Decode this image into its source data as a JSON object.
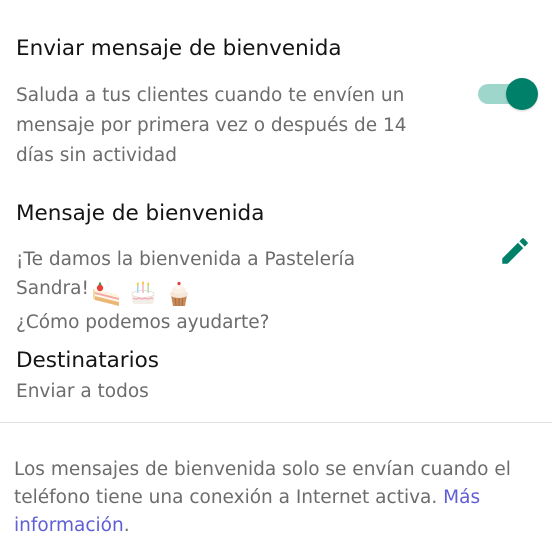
{
  "welcome": {
    "title": "Enviar mensaje de bienvenida",
    "description": "Saluda a tus clientes cuando te envíen un mensaje por primera vez o después de 14 días sin actividad",
    "toggle_on": true,
    "toggle_color": "#008069",
    "toggle_track_color": "#9fd6cc"
  },
  "message": {
    "title": "Mensaje de bienvenida",
    "line1": "¡Te damos la bienvenida a Pastelería",
    "line2": "Sandra!",
    "emojis": [
      "shortcake-emoji",
      "birthday-cake-emoji",
      "cupcake-emoji"
    ],
    "line3": "¿Cómo podemos ayudarte?",
    "edit_icon": "pencil-icon",
    "edit_icon_color": "#008069"
  },
  "recipients": {
    "title": "Destinatarios",
    "value": "Enviar a todos"
  },
  "footer": {
    "note": "Los mensajes de bienvenida solo se envían cuando el teléfono tiene una conexión a Internet activa. ",
    "link": "Más información",
    "period": ".",
    "link_color": "#5e5ed6"
  }
}
